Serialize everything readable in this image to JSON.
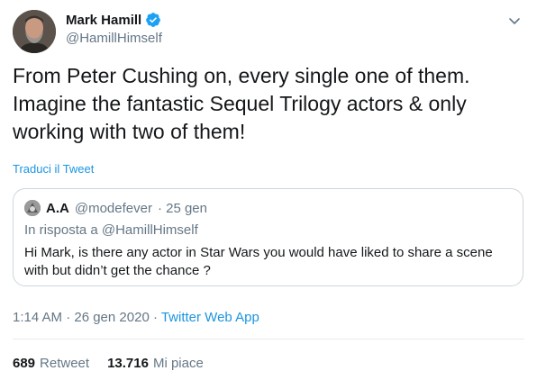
{
  "author": {
    "display_name": "Mark Hamill",
    "handle": "@HamillHimself",
    "verified": true
  },
  "tweet": {
    "text": "From Peter Cushing on, every single one of them. Imagine the fantastic Sequel Trilogy actors & only working with two of them!",
    "translate_label": "Traduci il Tweet"
  },
  "quoted_tweet": {
    "display_name": "A.A",
    "handle": "@modefever",
    "date": "· 25 gen",
    "reply_to": "In risposta a @HamillHimself",
    "text": "Hi Mark, is there any actor in Star Wars you would have liked to share a scene with but didn’t get the chance ?"
  },
  "meta": {
    "timestamp": "1:14 AM · 26 gen 2020 · ",
    "source": "Twitter Web App"
  },
  "stats": {
    "retweets_value": "689",
    "retweets_label": "Retweet",
    "likes_value": "13.716",
    "likes_label": "Mi piace"
  },
  "icons": {
    "verified": "verified-badge-icon",
    "caret": "chevron-down-icon"
  },
  "colors": {
    "link": "#1b95e0",
    "secondary_text": "#657786",
    "primary_text": "#14171a",
    "border": "#ccd6dd"
  }
}
